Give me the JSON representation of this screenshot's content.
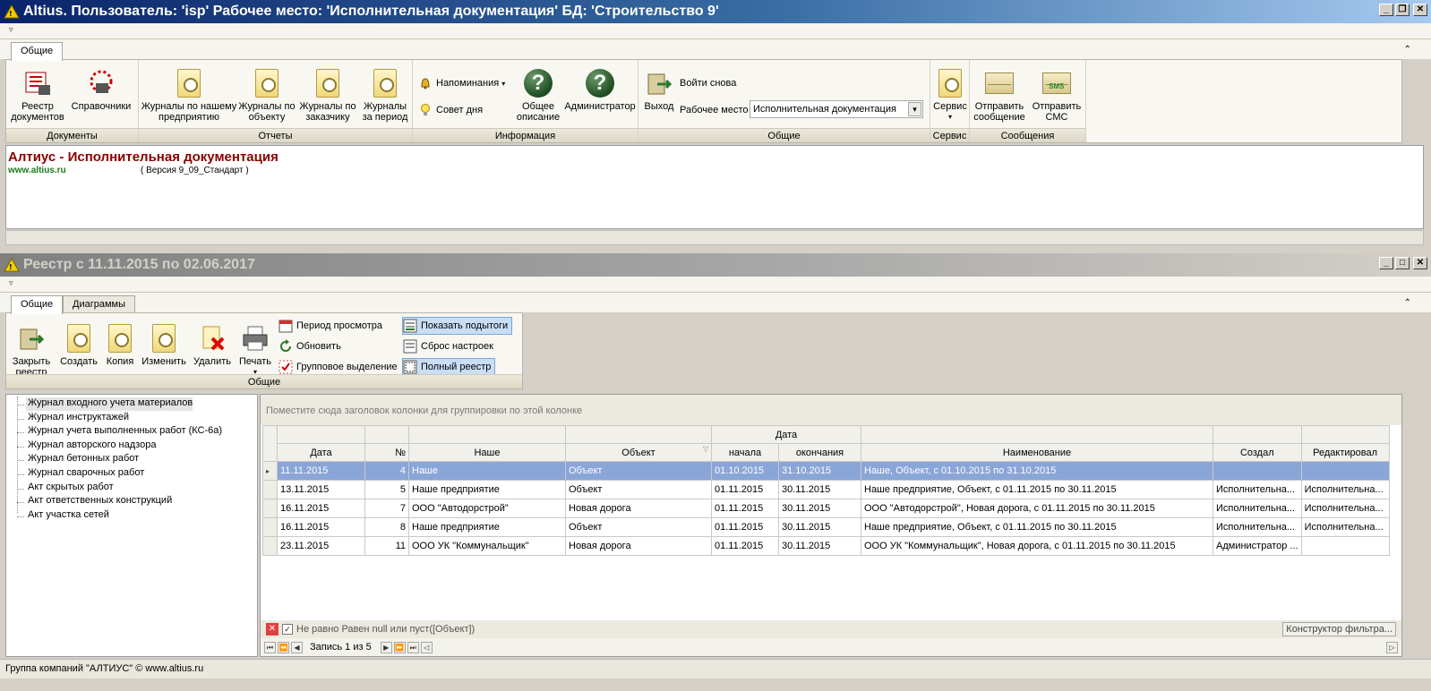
{
  "main_window": {
    "title": "Altius. Пользователь: 'isp' Рабочее место: 'Исполнительная документация' БД: 'Строительство 9'",
    "tab": "Общие",
    "groups": {
      "documents": {
        "caption": "Документы",
        "registry": "Реестр документов",
        "directories": "Справочники"
      },
      "reports": {
        "caption": "Отчеты",
        "by_company": "Журналы по нашему предприятию",
        "by_object": "Журналы по объекту",
        "by_customer": "Журналы по заказчику",
        "by_period": "Журналы за период"
      },
      "info": {
        "caption": "Информация",
        "reminders": "Напоминания",
        "tip": "Совет дня",
        "description": "Общее описание",
        "admin": "Администратор"
      },
      "general": {
        "caption": "Общие",
        "exit": "Выход",
        "relogin": "Войти снова",
        "workplace_label": "Рабочее место",
        "workplace_value": "Исполнительная документация"
      },
      "service": {
        "caption": "Сервис",
        "label": "Сервис"
      },
      "messages": {
        "caption": "Сообщения",
        "send_message": "Отправить сообщение",
        "send_sms": "Отправить СМС",
        "sms_icon_text": "SMS"
      }
    },
    "info_area": {
      "product": "Алтиус - Исполнительная документация",
      "site": "www.altius.ru",
      "version": "( Версия 9_09_Стандарт        )"
    }
  },
  "registry_window": {
    "title": "Реестр с 11.11.2015 по 02.06.2017",
    "tabs": [
      "Общие",
      "Диаграммы"
    ],
    "toolbar": {
      "caption": "Общие",
      "close": "Закрыть реестр",
      "create": "Создать",
      "copy": "Копия",
      "edit": "Изменить",
      "delete": "Удалить",
      "print": "Печать",
      "period": "Период просмотра",
      "refresh": "Обновить",
      "group_select": "Групповое выделение",
      "show_subtotals": "Показать подытоги",
      "reset_settings": "Сброс настроек",
      "full_registry": "Полный реестр"
    },
    "tree": [
      "Журнал входного учета материалов",
      "Журнал инструктажей",
      "Журнал учета выполненных работ (КС-6а)",
      "Журнал авторского надзора",
      "Журнал бетонных работ",
      "Журнал сварочных работ",
      "Акт скрытых работ",
      "Акт ответственных конструкций",
      "Акт участка сетей"
    ],
    "grid": {
      "group_panel_hint": "Поместите сюда заголовок колонки для группировки по этой колонке",
      "band_date": "Дата",
      "columns": {
        "date": "Дата",
        "num": "№",
        "ours": "Наше",
        "object": "Объект",
        "start": "начала",
        "end": "окончания",
        "name": "Наименование",
        "created": "Создал",
        "edited": "Редактировал"
      },
      "rows": [
        {
          "date": "11.11.2015",
          "num": "4",
          "ours": "Наше",
          "object": "Объект",
          "start": "01.10.2015",
          "end": "31.10.2015",
          "name": "Наше, Объект, с 01.10.2015 по 31.10.2015",
          "created": "",
          "edited": ""
        },
        {
          "date": "13.11.2015",
          "num": "5",
          "ours": "Наше предприятие",
          "object": "Объект",
          "start": "01.11.2015",
          "end": "30.11.2015",
          "name": "Наше предприятие, Объект, с 01.11.2015 по 30.11.2015",
          "created": "Исполнительна...",
          "edited": "Исполнительна..."
        },
        {
          "date": "16.11.2015",
          "num": "7",
          "ours": "ООО \"Автодорстрой\"",
          "object": "Новая дорога",
          "start": "01.11.2015",
          "end": "30.11.2015",
          "name": "ООО \"Автодорстрой\", Новая дорога, с 01.11.2015 по 30.11.2015",
          "created": "Исполнительна...",
          "edited": "Исполнительна..."
        },
        {
          "date": "16.11.2015",
          "num": "8",
          "ours": "Наше предприятие",
          "object": "Объект",
          "start": "01.11.2015",
          "end": "30.11.2015",
          "name": "Наше предприятие, Объект, с 01.11.2015 по 30.11.2015",
          "created": "Исполнительна...",
          "edited": "Исполнительна..."
        },
        {
          "date": "23.11.2015",
          "num": "11",
          "ours": "ООО УК \"Коммунальщик\"",
          "object": "Новая дорога",
          "start": "01.11.2015",
          "end": "30.11.2015",
          "name": "ООО УК \"Коммунальщик\", Новая дорога, с 01.11.2015 по 30.11.2015",
          "created": "Администратор ...",
          "edited": ""
        }
      ],
      "filter_text": "Не равно Равен null или пуст([Объект])",
      "filter_builder": "Конструктор фильтра...",
      "record_nav": "Запись 1 из 5"
    }
  },
  "status": "Группа компаний \"АЛТИУС\" © www.altius.ru",
  "colors": {
    "title_active": "#0a246a",
    "selected_row": "#8aa5d8",
    "product_title": "#8b0000",
    "site_link": "#1a7a1a"
  }
}
